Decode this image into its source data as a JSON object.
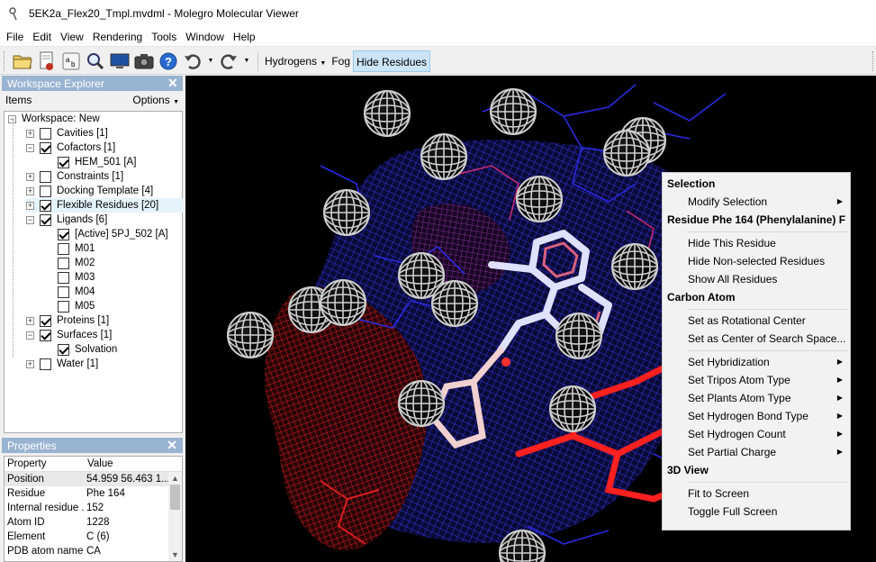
{
  "window": {
    "title": "5EK2a_Flex20_Tmpl.mvdml - Molegro Molecular Viewer"
  },
  "menubar": [
    "File",
    "Edit",
    "View",
    "Rendering",
    "Tools",
    "Window",
    "Help"
  ],
  "toolbar": {
    "hydrogens_label": "Hydrogens",
    "fog_label": "Fog",
    "hide_residues_label": "Hide Residues"
  },
  "workspace_explorer": {
    "title": "Workspace Explorer",
    "items_label": "Items",
    "options_label": "Options",
    "tree": [
      {
        "label": "Workspace: New",
        "level": 0,
        "expander": "−",
        "checkbox": "none"
      },
      {
        "label": "Cavities [1]",
        "level": 1,
        "expander": "+",
        "checkbox": "unchecked"
      },
      {
        "label": "Cofactors [1]",
        "level": 1,
        "expander": "−",
        "checkbox": "checked"
      },
      {
        "label": "HEM_501 [A]",
        "level": 2,
        "expander": "",
        "checkbox": "checked"
      },
      {
        "label": "Constraints [1]",
        "level": 1,
        "expander": "+",
        "checkbox": "unchecked"
      },
      {
        "label": "Docking Template [4]",
        "level": 1,
        "expander": "+",
        "checkbox": "unchecked"
      },
      {
        "label": "Flexible Residues [20]",
        "level": 1,
        "expander": "+",
        "checkbox": "checked",
        "highlight": true
      },
      {
        "label": "Ligands [6]",
        "level": 1,
        "expander": "−",
        "checkbox": "checked"
      },
      {
        "label": "[Active] 5PJ_502 [A]",
        "level": 2,
        "expander": "",
        "checkbox": "checked"
      },
      {
        "label": "M01",
        "level": 2,
        "expander": "",
        "checkbox": "unchecked"
      },
      {
        "label": "M02",
        "level": 2,
        "expander": "",
        "checkbox": "unchecked"
      },
      {
        "label": "M03",
        "level": 2,
        "expander": "",
        "checkbox": "unchecked"
      },
      {
        "label": "M04",
        "level": 2,
        "expander": "",
        "checkbox": "unchecked"
      },
      {
        "label": "M05",
        "level": 2,
        "expander": "",
        "checkbox": "unchecked"
      },
      {
        "label": "Proteins [1]",
        "level": 1,
        "expander": "+",
        "checkbox": "checked"
      },
      {
        "label": "Surfaces [1]",
        "level": 1,
        "expander": "−",
        "checkbox": "checked"
      },
      {
        "label": "Solvation",
        "level": 2,
        "expander": "",
        "checkbox": "checked"
      },
      {
        "label": "Water [1]",
        "level": 1,
        "expander": "+",
        "checkbox": "unchecked"
      }
    ]
  },
  "properties": {
    "title": "Properties",
    "columns": [
      "Property",
      "Value"
    ],
    "rows": [
      {
        "key": "Position",
        "value": "54.959 56.463 1...",
        "selected": true
      },
      {
        "key": "Residue",
        "value": "Phe 164"
      },
      {
        "key": "Internal residue ...",
        "value": "152"
      },
      {
        "key": "Atom ID",
        "value": "1228"
      },
      {
        "key": "Element",
        "value": "C (6)"
      },
      {
        "key": "PDB atom name",
        "value": "CA"
      }
    ]
  },
  "context_menu": {
    "entries": [
      {
        "type": "header",
        "label": "Selection"
      },
      {
        "type": "item",
        "label": "Modify Selection",
        "submenu": true
      },
      {
        "type": "header",
        "label": "Residue Phe 164 (Phenylalanine) F"
      },
      {
        "type": "sep"
      },
      {
        "type": "item",
        "label": "Hide This Residue"
      },
      {
        "type": "item",
        "label": "Hide Non-selected Residues"
      },
      {
        "type": "item",
        "label": "Show All Residues"
      },
      {
        "type": "header",
        "label": "Carbon Atom"
      },
      {
        "type": "sep"
      },
      {
        "type": "item",
        "label": "Set as Rotational Center"
      },
      {
        "type": "item",
        "label": "Set as Center of Search Space..."
      },
      {
        "type": "sep"
      },
      {
        "type": "item",
        "label": "Set Hybridization",
        "submenu": true
      },
      {
        "type": "item",
        "label": "Set Tripos Atom Type",
        "submenu": true
      },
      {
        "type": "item",
        "label": "Set Plants Atom Type",
        "submenu": true
      },
      {
        "type": "item",
        "label": "Set Hydrogen Bond Type",
        "submenu": true
      },
      {
        "type": "item",
        "label": "Set Hydrogen Count",
        "submenu": true
      },
      {
        "type": "item",
        "label": "Set Partial Charge",
        "submenu": true
      },
      {
        "type": "header",
        "label": "3D View"
      },
      {
        "type": "sep"
      },
      {
        "type": "item",
        "label": "Fit to Screen"
      },
      {
        "type": "item",
        "label": "Toggle Full Screen"
      }
    ]
  },
  "colors": {
    "panel_header": "#99b4d1",
    "viewport_bg": "#000000",
    "surface_blue": "#2a2ad0",
    "surface_red": "#d01818",
    "cage_gray": "#c8c8c8"
  }
}
